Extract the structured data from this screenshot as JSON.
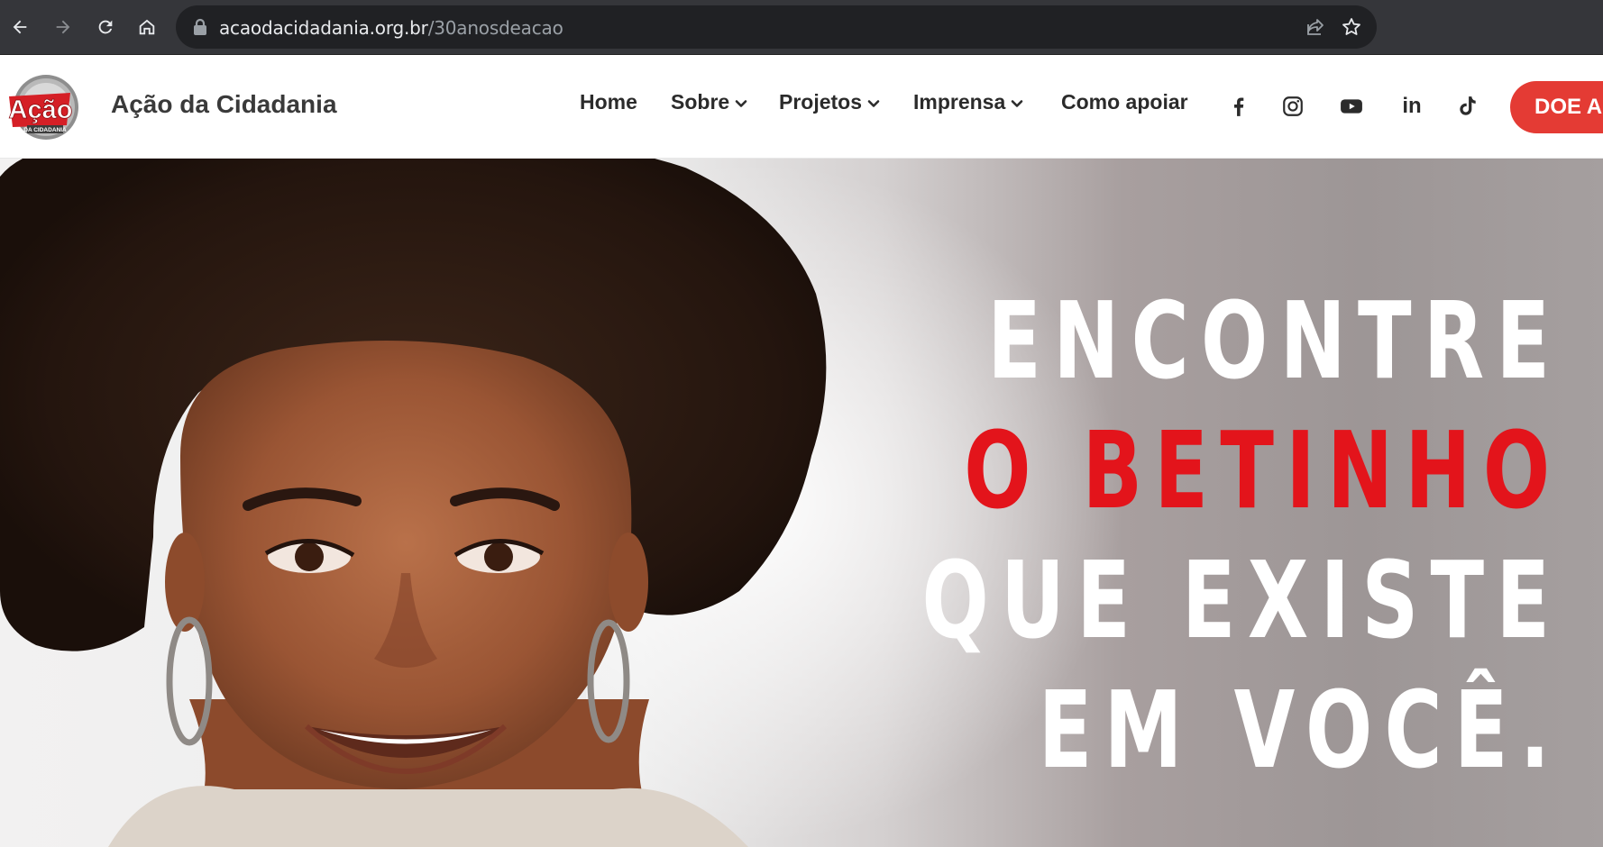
{
  "browser": {
    "url_domain": "acaodacidadania.org.br",
    "url_path": "/30anosdeacao",
    "icons": [
      "back-icon",
      "forward-icon",
      "reload-icon",
      "home-icon",
      "lock-icon",
      "share-icon",
      "bookmark-star-icon"
    ]
  },
  "header": {
    "logo": {
      "text_main": "Ação",
      "text_sub": "DA CIDADANIA"
    },
    "brand_name": "Ação da Cidadania",
    "menu": [
      {
        "label": "Home",
        "dropdown": false
      },
      {
        "label": "Sobre",
        "dropdown": true
      },
      {
        "label": "Projetos",
        "dropdown": true
      },
      {
        "label": "Imprensa",
        "dropdown": true
      },
      {
        "label": "Como apoiar",
        "dropdown": false
      }
    ],
    "social": [
      {
        "name": "facebook-icon"
      },
      {
        "name": "instagram-icon"
      },
      {
        "name": "youtube-icon"
      },
      {
        "name": "linkedin-icon",
        "text": "in"
      },
      {
        "name": "tiktok-icon"
      }
    ],
    "donate_label": "DOE A"
  },
  "hero": {
    "headline": {
      "line1": "ENCONTRE",
      "line2": "O BETINHO",
      "line3": "QUE EXISTE",
      "line4": "EM VOCÊ."
    }
  },
  "colors": {
    "accent_red": "#e3141b",
    "donate_button": "#e43b34",
    "chrome_bg": "#35363a",
    "omnibox_bg": "#202124"
  }
}
